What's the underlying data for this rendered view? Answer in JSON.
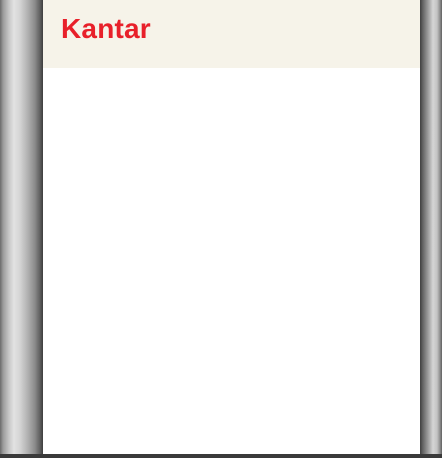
{
  "app": {
    "title": "Kantar"
  },
  "colors": {
    "title": "#e8202a",
    "header_background": "#f6f3e9",
    "content_background": "#ffffff",
    "bezel": "#9a9a9a"
  }
}
